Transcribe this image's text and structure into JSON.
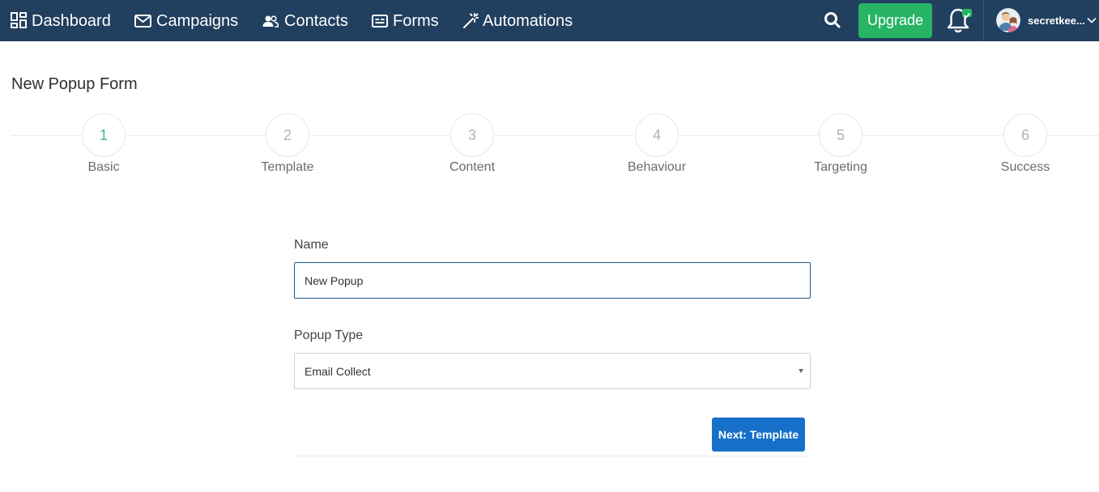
{
  "nav": {
    "items": [
      {
        "label": "Dashboard",
        "icon": "dashboard-grid-icon"
      },
      {
        "label": "Campaigns",
        "icon": "envelope-icon"
      },
      {
        "label": "Contacts",
        "icon": "people-icon"
      },
      {
        "label": "Forms",
        "icon": "form-icon"
      },
      {
        "label": "Automations",
        "icon": "magic-wand-icon"
      }
    ],
    "search_icon": "search-icon",
    "upgrade_label": "Upgrade",
    "bell_icon": "bell-icon",
    "user_name": "secretkee...",
    "user_caret_icon": "chevron-down-icon",
    "bar_color": "#213f5f",
    "upgrade_color": "#27b565"
  },
  "page": {
    "title": "New Popup Form"
  },
  "stepper": {
    "active_step": 1,
    "active_color": "#3dbb77",
    "steps": [
      {
        "number": "1",
        "label": "Basic"
      },
      {
        "number": "2",
        "label": "Template"
      },
      {
        "number": "3",
        "label": "Content"
      },
      {
        "number": "4",
        "label": "Behaviour"
      },
      {
        "number": "5",
        "label": "Targeting"
      },
      {
        "number": "6",
        "label": "Success"
      }
    ]
  },
  "form": {
    "name_label": "Name",
    "name_value": "New Popup",
    "type_label": "Popup Type",
    "type_value": "Email Collect",
    "next_label": "Next: Template",
    "next_color": "#1670c9"
  }
}
